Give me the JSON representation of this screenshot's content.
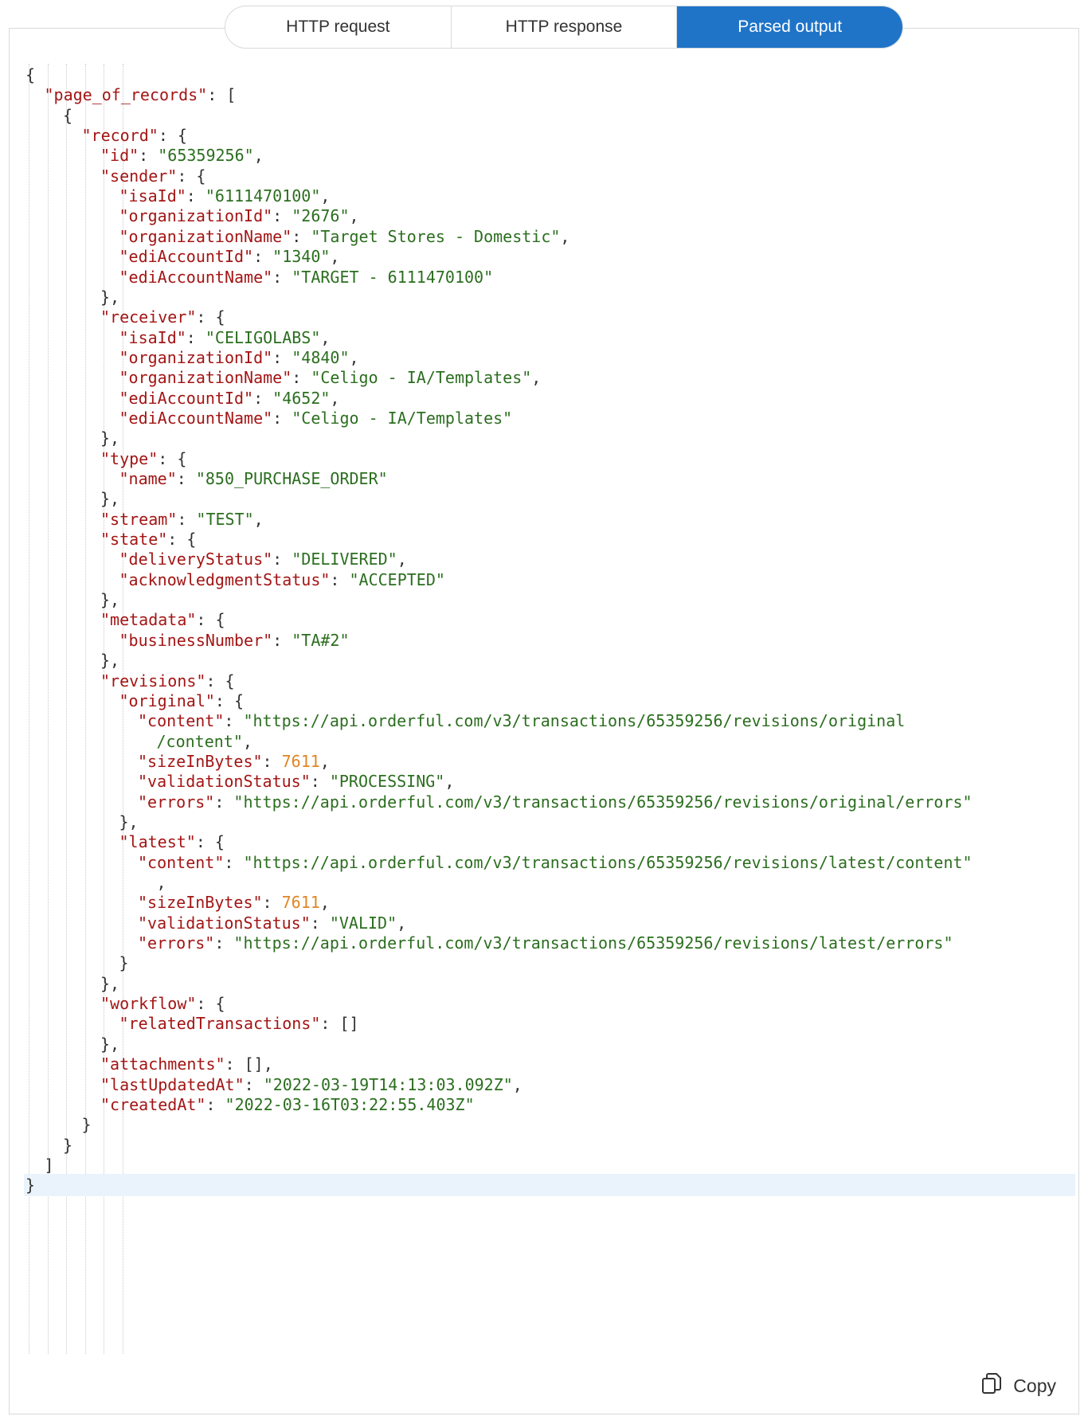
{
  "tabs": [
    {
      "label": "HTTP request",
      "active": false
    },
    {
      "label": "HTTP response",
      "active": false
    },
    {
      "label": "Parsed output",
      "active": true
    }
  ],
  "copy_label": "Copy",
  "copy_icon": "copy-icon",
  "colors": {
    "accent": "#1f74c8",
    "key": "#a31515",
    "string": "#2b6e1f",
    "number": "#e08524"
  },
  "code_lines": [
    {
      "indent": 0,
      "parts": [
        [
          "p",
          "{"
        ]
      ]
    },
    {
      "indent": 1,
      "parts": [
        [
          "k",
          "\"page_of_records\""
        ],
        [
          "p",
          ": ["
        ]
      ]
    },
    {
      "indent": 2,
      "parts": [
        [
          "p",
          "{"
        ]
      ]
    },
    {
      "indent": 3,
      "parts": [
        [
          "k",
          "\"record\""
        ],
        [
          "p",
          ": {"
        ]
      ]
    },
    {
      "indent": 4,
      "parts": [
        [
          "k",
          "\"id\""
        ],
        [
          "p",
          ": "
        ],
        [
          "s",
          "\"65359256\""
        ],
        [
          "p",
          ","
        ]
      ]
    },
    {
      "indent": 4,
      "parts": [
        [
          "k",
          "\"sender\""
        ],
        [
          "p",
          ": {"
        ]
      ]
    },
    {
      "indent": 5,
      "parts": [
        [
          "k",
          "\"isaId\""
        ],
        [
          "p",
          ": "
        ],
        [
          "s",
          "\"6111470100\""
        ],
        [
          "p",
          ","
        ]
      ]
    },
    {
      "indent": 5,
      "parts": [
        [
          "k",
          "\"organizationId\""
        ],
        [
          "p",
          ": "
        ],
        [
          "s",
          "\"2676\""
        ],
        [
          "p",
          ","
        ]
      ]
    },
    {
      "indent": 5,
      "parts": [
        [
          "k",
          "\"organizationName\""
        ],
        [
          "p",
          ": "
        ],
        [
          "s",
          "\"Target Stores - Domestic\""
        ],
        [
          "p",
          ","
        ]
      ]
    },
    {
      "indent": 5,
      "parts": [
        [
          "k",
          "\"ediAccountId\""
        ],
        [
          "p",
          ": "
        ],
        [
          "s",
          "\"1340\""
        ],
        [
          "p",
          ","
        ]
      ]
    },
    {
      "indent": 5,
      "parts": [
        [
          "k",
          "\"ediAccountName\""
        ],
        [
          "p",
          ": "
        ],
        [
          "s",
          "\"TARGET - 6111470100\""
        ]
      ]
    },
    {
      "indent": 4,
      "parts": [
        [
          "p",
          "},"
        ]
      ]
    },
    {
      "indent": 4,
      "parts": [
        [
          "k",
          "\"receiver\""
        ],
        [
          "p",
          ": {"
        ]
      ]
    },
    {
      "indent": 5,
      "parts": [
        [
          "k",
          "\"isaId\""
        ],
        [
          "p",
          ": "
        ],
        [
          "s",
          "\"CELIGOLABS\""
        ],
        [
          "p",
          ","
        ]
      ]
    },
    {
      "indent": 5,
      "parts": [
        [
          "k",
          "\"organizationId\""
        ],
        [
          "p",
          ": "
        ],
        [
          "s",
          "\"4840\""
        ],
        [
          "p",
          ","
        ]
      ]
    },
    {
      "indent": 5,
      "parts": [
        [
          "k",
          "\"organizationName\""
        ],
        [
          "p",
          ": "
        ],
        [
          "s",
          "\"Celigo - IA/Templates\""
        ],
        [
          "p",
          ","
        ]
      ]
    },
    {
      "indent": 5,
      "parts": [
        [
          "k",
          "\"ediAccountId\""
        ],
        [
          "p",
          ": "
        ],
        [
          "s",
          "\"4652\""
        ],
        [
          "p",
          ","
        ]
      ]
    },
    {
      "indent": 5,
      "parts": [
        [
          "k",
          "\"ediAccountName\""
        ],
        [
          "p",
          ": "
        ],
        [
          "s",
          "\"Celigo - IA/Templates\""
        ]
      ]
    },
    {
      "indent": 4,
      "parts": [
        [
          "p",
          "},"
        ]
      ]
    },
    {
      "indent": 4,
      "parts": [
        [
          "k",
          "\"type\""
        ],
        [
          "p",
          ": {"
        ]
      ]
    },
    {
      "indent": 5,
      "parts": [
        [
          "k",
          "\"name\""
        ],
        [
          "p",
          ": "
        ],
        [
          "s",
          "\"850_PURCHASE_ORDER\""
        ]
      ]
    },
    {
      "indent": 4,
      "parts": [
        [
          "p",
          "},"
        ]
      ]
    },
    {
      "indent": 4,
      "parts": [
        [
          "k",
          "\"stream\""
        ],
        [
          "p",
          ": "
        ],
        [
          "s",
          "\"TEST\""
        ],
        [
          "p",
          ","
        ]
      ]
    },
    {
      "indent": 4,
      "parts": [
        [
          "k",
          "\"state\""
        ],
        [
          "p",
          ": {"
        ]
      ]
    },
    {
      "indent": 5,
      "parts": [
        [
          "k",
          "\"deliveryStatus\""
        ],
        [
          "p",
          ": "
        ],
        [
          "s",
          "\"DELIVERED\""
        ],
        [
          "p",
          ","
        ]
      ]
    },
    {
      "indent": 5,
      "parts": [
        [
          "k",
          "\"acknowledgmentStatus\""
        ],
        [
          "p",
          ": "
        ],
        [
          "s",
          "\"ACCEPTED\""
        ]
      ]
    },
    {
      "indent": 4,
      "parts": [
        [
          "p",
          "},"
        ]
      ]
    },
    {
      "indent": 4,
      "parts": [
        [
          "k",
          "\"metadata\""
        ],
        [
          "p",
          ": {"
        ]
      ]
    },
    {
      "indent": 5,
      "parts": [
        [
          "k",
          "\"businessNumber\""
        ],
        [
          "p",
          ": "
        ],
        [
          "s",
          "\"TA#2\""
        ]
      ]
    },
    {
      "indent": 4,
      "parts": [
        [
          "p",
          "},"
        ]
      ]
    },
    {
      "indent": 4,
      "parts": [
        [
          "k",
          "\"revisions\""
        ],
        [
          "p",
          ": {"
        ]
      ]
    },
    {
      "indent": 5,
      "parts": [
        [
          "k",
          "\"original\""
        ],
        [
          "p",
          ": {"
        ]
      ]
    },
    {
      "indent": 6,
      "parts": [
        [
          "k",
          "\"content\""
        ],
        [
          "p",
          ": "
        ],
        [
          "s",
          "\"https://api.orderful.com/v3/transactions/65359256/revisions/original"
        ]
      ]
    },
    {
      "indent": 6,
      "wrap": true,
      "parts": [
        [
          "s",
          "/content\""
        ],
        [
          "p",
          ","
        ]
      ]
    },
    {
      "indent": 6,
      "parts": [
        [
          "k",
          "\"sizeInBytes\""
        ],
        [
          "p",
          ": "
        ],
        [
          "n",
          "7611"
        ],
        [
          "p",
          ","
        ]
      ]
    },
    {
      "indent": 6,
      "parts": [
        [
          "k",
          "\"validationStatus\""
        ],
        [
          "p",
          ": "
        ],
        [
          "s",
          "\"PROCESSING\""
        ],
        [
          "p",
          ","
        ]
      ]
    },
    {
      "indent": 6,
      "parts": [
        [
          "k",
          "\"errors\""
        ],
        [
          "p",
          ": "
        ],
        [
          "s",
          "\"https://api.orderful.com/v3/transactions/65359256/revisions/original/errors\""
        ]
      ]
    },
    {
      "indent": 5,
      "parts": [
        [
          "p",
          "},"
        ]
      ]
    },
    {
      "indent": 5,
      "parts": [
        [
          "k",
          "\"latest\""
        ],
        [
          "p",
          ": {"
        ]
      ]
    },
    {
      "indent": 6,
      "parts": [
        [
          "k",
          "\"content\""
        ],
        [
          "p",
          ": "
        ],
        [
          "s",
          "\"https://api.orderful.com/v3/transactions/65359256/revisions/latest/content\""
        ]
      ]
    },
    {
      "indent": 6,
      "wrap": true,
      "parts": [
        [
          "p",
          ","
        ]
      ]
    },
    {
      "indent": 6,
      "parts": [
        [
          "k",
          "\"sizeInBytes\""
        ],
        [
          "p",
          ": "
        ],
        [
          "n",
          "7611"
        ],
        [
          "p",
          ","
        ]
      ]
    },
    {
      "indent": 6,
      "parts": [
        [
          "k",
          "\"validationStatus\""
        ],
        [
          "p",
          ": "
        ],
        [
          "s",
          "\"VALID\""
        ],
        [
          "p",
          ","
        ]
      ]
    },
    {
      "indent": 6,
      "parts": [
        [
          "k",
          "\"errors\""
        ],
        [
          "p",
          ": "
        ],
        [
          "s",
          "\"https://api.orderful.com/v3/transactions/65359256/revisions/latest/errors\""
        ]
      ]
    },
    {
      "indent": 5,
      "parts": [
        [
          "p",
          "}"
        ]
      ]
    },
    {
      "indent": 4,
      "parts": [
        [
          "p",
          "},"
        ]
      ]
    },
    {
      "indent": 4,
      "parts": [
        [
          "k",
          "\"workflow\""
        ],
        [
          "p",
          ": {"
        ]
      ]
    },
    {
      "indent": 5,
      "parts": [
        [
          "k",
          "\"relatedTransactions\""
        ],
        [
          "p",
          ": []"
        ]
      ]
    },
    {
      "indent": 4,
      "parts": [
        [
          "p",
          "},"
        ]
      ]
    },
    {
      "indent": 4,
      "parts": [
        [
          "k",
          "\"attachments\""
        ],
        [
          "p",
          ": [],"
        ]
      ]
    },
    {
      "indent": 4,
      "parts": [
        [
          "k",
          "\"lastUpdatedAt\""
        ],
        [
          "p",
          ": "
        ],
        [
          "s",
          "\"2022-03-19T14:13:03.092Z\""
        ],
        [
          "p",
          ","
        ]
      ]
    },
    {
      "indent": 4,
      "parts": [
        [
          "k",
          "\"createdAt\""
        ],
        [
          "p",
          ": "
        ],
        [
          "s",
          "\"2022-03-16T03:22:55.403Z\""
        ]
      ]
    },
    {
      "indent": 3,
      "parts": [
        [
          "p",
          "}"
        ]
      ]
    },
    {
      "indent": 2,
      "parts": [
        [
          "p",
          "}"
        ]
      ]
    },
    {
      "indent": 1,
      "parts": [
        [
          "p",
          "]"
        ]
      ]
    },
    {
      "indent": 0,
      "cursor": true,
      "parts": [
        [
          "p",
          "}"
        ]
      ]
    }
  ]
}
